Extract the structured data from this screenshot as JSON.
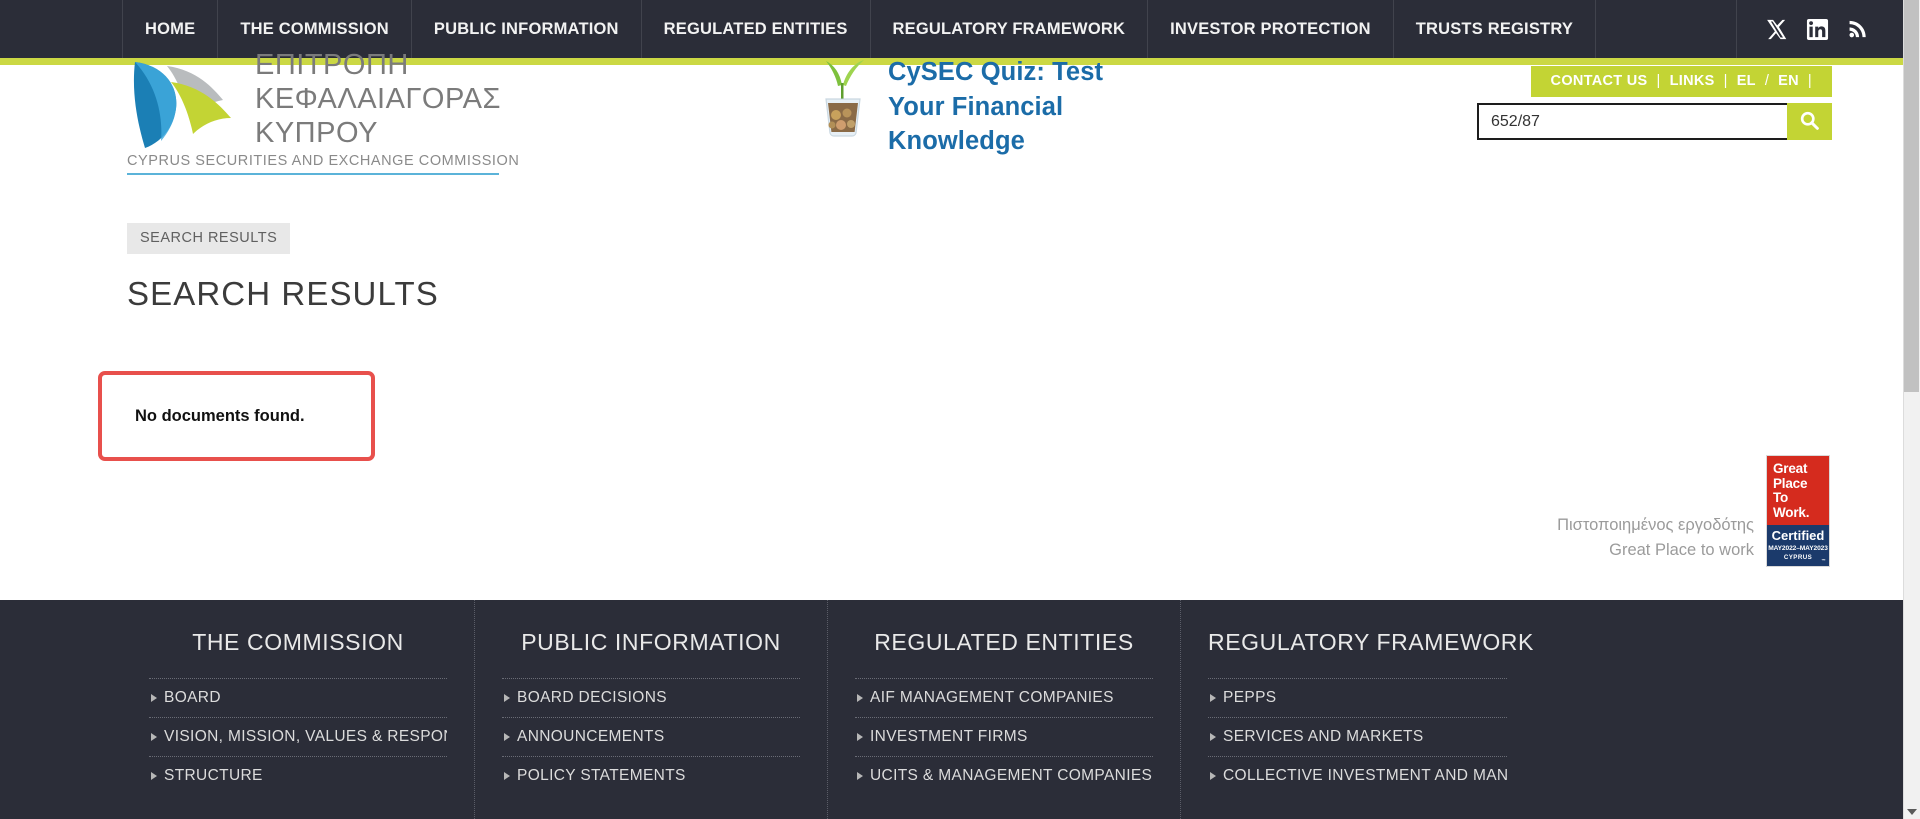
{
  "nav": {
    "items": [
      {
        "label": "HOME",
        "name": "nav-item-home"
      },
      {
        "label": "THE COMMISSION",
        "name": "nav-item-the-commission"
      },
      {
        "label": "PUBLIC INFORMATION",
        "name": "nav-item-public-information"
      },
      {
        "label": "REGULATED ENTITIES",
        "name": "nav-item-regulated-entities"
      },
      {
        "label": "REGULATORY FRAMEWORK",
        "name": "nav-item-regulatory-framework"
      },
      {
        "label": "INVESTOR PROTECTION",
        "name": "nav-item-investor-protection"
      },
      {
        "label": "TRUSTS REGISTRY",
        "name": "nav-item-trusts-registry"
      }
    ],
    "social": [
      {
        "icon": "x-twitter-icon",
        "label": "X"
      },
      {
        "icon": "linkedin-icon",
        "label": "LinkedIn"
      },
      {
        "icon": "rss-icon",
        "label": "RSS"
      }
    ],
    "accent_color": "#cbd844",
    "background_color": "#2b2d38"
  },
  "logo": {
    "greek_line1": "ΕΠΙΤΡΟΠΗ",
    "greek_line2": "ΚΕΦΑΛΑΙΑΓΟΡΑΣ",
    "greek_line3": "ΚΥΠΡΟΥ",
    "english": "CYPRUS SECURITIES AND EXCHANGE COMMISSION"
  },
  "quiz_banner": {
    "title": "CySEC Quiz: Test\nYour Financial\nKnowledge",
    "color": "#1b6ca8"
  },
  "utility": {
    "contact_us": "CONTACT US",
    "links": "LINKS",
    "lang_el": "EL",
    "lang_en": "EN",
    "separator": "|",
    "slash": "/",
    "background_color": "#c3d434"
  },
  "search": {
    "value": "652/87",
    "placeholder": "",
    "button_icon": "search-icon"
  },
  "main": {
    "breadcrumb": "SEARCH RESULTS",
    "page_title": "SEARCH RESULTS",
    "alert_message": "No documents found.",
    "alert_border_color": "#e8504c"
  },
  "gptw": {
    "caption": "Πιστοποιημένος εργοδότης\nGreat Place to work",
    "badge_line1": "Great",
    "badge_line2": "Place",
    "badge_line3": "To",
    "badge_line4": "Work.",
    "certified": "Certified",
    "dates": "MAY2022–MAY2023",
    "country": "CYPRUS",
    "tm": "™",
    "red": "#d52b1e",
    "navy": "#1b3a6b"
  },
  "footer": {
    "columns": [
      {
        "title": "THE COMMISSION",
        "items": [
          "BOARD",
          "VISION, MISSION, VALUES & RESPONSIBILITIES...",
          "STRUCTURE"
        ]
      },
      {
        "title": "PUBLIC INFORMATION",
        "items": [
          "BOARD DECISIONS",
          "ANNOUNCEMENTS",
          "POLICY STATEMENTS"
        ]
      },
      {
        "title": "REGULATED ENTITIES",
        "items": [
          "AIF MANAGEMENT COMPANIES",
          "INVESTMENT FIRMS",
          "UCITS & MANAGEMENT COMPANIES"
        ]
      },
      {
        "title": "REGULATORY FRAMEWORK",
        "items": [
          "PEPPS",
          "SERVICES AND MARKETS",
          "COLLECTIVE INVESTMENT AND MANAGERS"
        ]
      }
    ]
  }
}
